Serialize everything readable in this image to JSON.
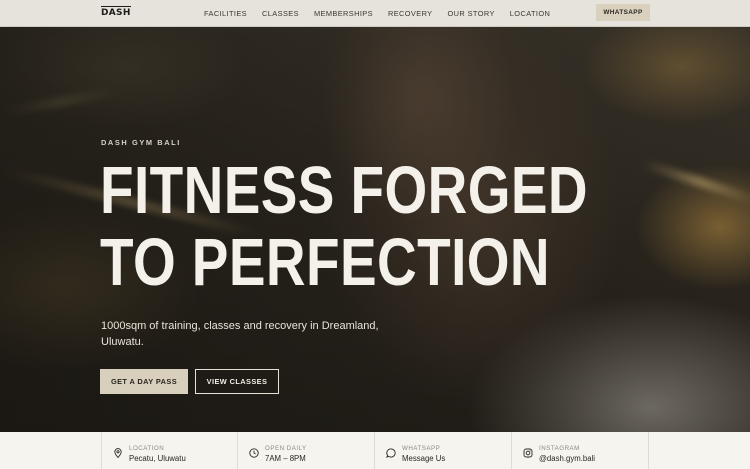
{
  "nav": {
    "logo": "DASH",
    "links": [
      "FACILITIES",
      "CLASSES",
      "MEMBERSHIPS",
      "RECOVERY",
      "OUR STORY",
      "LOCATION"
    ],
    "cta": "WHATSAPP"
  },
  "hero": {
    "eyebrow": "DASH GYM BALI",
    "headline_line1": "FITNESS FORGED",
    "headline_line2": "TO PERFECTION",
    "subtext": "1000sqm of training, classes and recovery in Dreamland, Uluwatu.",
    "primary_button": "GET A DAY PASS",
    "secondary_button": "VIEW CLASSES"
  },
  "info": [
    {
      "label": "LOCATION",
      "value": "Pecatu, Uluwatu",
      "icon": "map-pin-icon"
    },
    {
      "label": "OPEN DAILY",
      "value": "7AM – 8PM",
      "icon": "clock-icon"
    },
    {
      "label": "WHATSAPP",
      "value": "Message Us",
      "icon": "chat-bubble-icon"
    },
    {
      "label": "INSTAGRAM",
      "value": "@dash.gym.bali",
      "icon": "instagram-icon"
    }
  ],
  "colors": {
    "nav_bg": "#e6e3dc",
    "accent_button": "#d8cfbc",
    "headline": "#f4f1ea",
    "infobar_bg": "#f6f4ef"
  }
}
